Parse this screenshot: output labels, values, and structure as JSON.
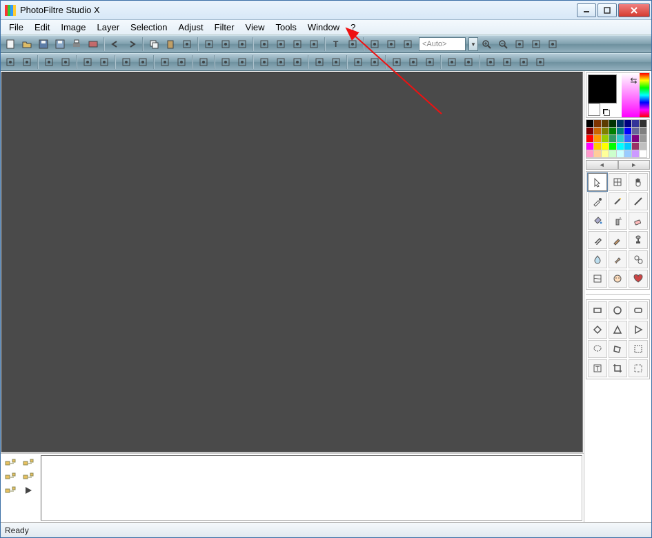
{
  "title": "PhotoFiltre Studio X",
  "menus": [
    "File",
    "Edit",
    "Image",
    "Layer",
    "Selection",
    "Adjust",
    "Filter",
    "View",
    "Tools",
    "Window",
    "?"
  ],
  "zoom_placeholder": "<Auto>",
  "status": "Ready",
  "toolbar1_icons": [
    "new",
    "open",
    "save",
    "save-as",
    "print",
    "twain",
    "sep",
    "undo",
    "redo",
    "sep",
    "copy",
    "paste",
    "image-size",
    "sep",
    "grayscale",
    "sepia",
    "dither",
    "sep",
    "flip-h",
    "flip-v",
    "rotate-ccw",
    "rotate-cw",
    "sep",
    "text",
    "line",
    "sep",
    "layers",
    "plugin",
    "options"
  ],
  "toolbar1_right_icons": [
    "zoom-in",
    "zoom-out",
    "fit",
    "fullscreen",
    "explorer"
  ],
  "toolbar2_icons": [
    "brightness-minus",
    "brightness-plus",
    "sep",
    "contrast-minus",
    "contrast-plus",
    "sep",
    "gamma-minus",
    "gamma-plus",
    "sep",
    "saturation-minus",
    "saturation-plus",
    "sep",
    "histogram",
    "levels",
    "sep",
    "gradient",
    "sep",
    "sharpen",
    "blur",
    "sep",
    "grid-a",
    "grid-b",
    "grid-c",
    "sep",
    "relief",
    "emboss",
    "sep",
    "drop",
    "rain",
    "sep",
    "perspective",
    "trapezoid",
    "mirror",
    "sep",
    "camera",
    "monitor",
    "sep",
    "frame",
    "frame2",
    "pattern",
    "export"
  ],
  "palette_colors": [
    "#000000",
    "#7f3300",
    "#5b3b00",
    "#003300",
    "#003366",
    "#000080",
    "#333399",
    "#333333",
    "#800000",
    "#cc6600",
    "#808000",
    "#008000",
    "#008080",
    "#0000ff",
    "#666699",
    "#808080",
    "#ff0000",
    "#ff9900",
    "#99cc00",
    "#339966",
    "#33cccc",
    "#3366ff",
    "#800080",
    "#999999",
    "#ff00ff",
    "#ffcc00",
    "#ffff00",
    "#00ff00",
    "#00ffff",
    "#00ccff",
    "#993366",
    "#c0c0c0",
    "#ff99cc",
    "#ffcc99",
    "#ffff99",
    "#ccffcc",
    "#ccffff",
    "#99ccff",
    "#cc99ff",
    "#ffffff"
  ],
  "tools": [
    "pointer",
    "grid",
    "hand",
    "picker",
    "wand",
    "line",
    "bucket",
    "spray",
    "eraser",
    "brush",
    "adv-brush",
    "stamp",
    "blur",
    "smudge",
    "clone",
    "distort",
    "face",
    "heart"
  ],
  "shapes": [
    "rect",
    "circle",
    "round-rect",
    "diamond",
    "triangle",
    "triangle-r",
    "lasso",
    "poly",
    "magic-sel",
    "text-frame",
    "crop",
    "sel-all"
  ],
  "layer_icons": [
    [
      "tree-a",
      "tree-b"
    ],
    [
      "tree-c",
      "tree-d"
    ],
    [
      "tree-e",
      "play"
    ]
  ],
  "nav": {
    "prev": "◄",
    "next": "►"
  }
}
